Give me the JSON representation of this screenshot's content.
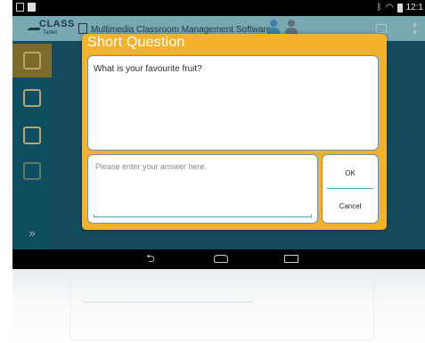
{
  "status_bar": {
    "time": "12:1"
  },
  "app": {
    "logo_text": "CLASS",
    "logo_sub": "Tablet",
    "title": "Multimedia Classroom Management Software"
  },
  "sidebar": {
    "items": [
      {
        "icon": "home-icon"
      },
      {
        "icon": "chat-icon"
      },
      {
        "icon": "document-download-icon"
      },
      {
        "icon": "document-icon"
      }
    ],
    "expand_label": "»"
  },
  "dialog": {
    "title": "Short Question",
    "question": "What is your favourite fruit?",
    "answer_value": "",
    "answer_placeholder": "Please enter your answer here.",
    "ok_label": "OK",
    "cancel_label": "Cancel"
  },
  "nav": {
    "back_glyph": "⮌"
  },
  "colors": {
    "dialog_accent": "#f4b22c",
    "app_background": "#0f4d61",
    "header_background": "#79a7b2",
    "field_border": "#6a8fb3"
  }
}
